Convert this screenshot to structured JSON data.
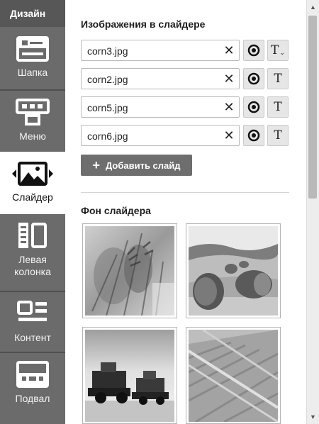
{
  "sidebar": {
    "title": "Дизайн",
    "items": [
      {
        "label": "Шапка",
        "icon": "header-layout-icon",
        "active": false
      },
      {
        "label": "Меню",
        "icon": "menu-layout-icon",
        "active": false
      },
      {
        "label": "Слайдер",
        "icon": "slider-image-icon",
        "active": true
      },
      {
        "label": "Левая колонка",
        "icon": "left-column-icon",
        "active": false
      },
      {
        "label": "Контент",
        "icon": "content-layout-icon",
        "active": false
      },
      {
        "label": "Подвал",
        "icon": "footer-layout-icon",
        "active": false
      }
    ]
  },
  "slider_images": {
    "title": "Изображения в слайдере",
    "slides": [
      {
        "filename": "corn3.jpg",
        "text_button": "T",
        "text_button_has_caret": true
      },
      {
        "filename": "corn2.jpg",
        "text_button": "T",
        "text_button_has_caret": false
      },
      {
        "filename": "corn5.jpg",
        "text_button": "T",
        "text_button_has_caret": false
      },
      {
        "filename": "corn6.jpg",
        "text_button": "T",
        "text_button_has_caret": false
      }
    ],
    "clear_symbol": "✕",
    "add_button": {
      "icon": "+",
      "label": "Добавить слайд"
    }
  },
  "slider_background": {
    "title": "Фон слайдера",
    "thumbnails": [
      {
        "name": "bg-thumb-wheat-closeup"
      },
      {
        "name": "bg-thumb-hay-bales"
      },
      {
        "name": "bg-thumb-combine-harvesters"
      },
      {
        "name": "bg-thumb-wheat-field"
      }
    ]
  },
  "scrollbar": {
    "up_symbol": "▲",
    "down_symbol": "▼"
  }
}
